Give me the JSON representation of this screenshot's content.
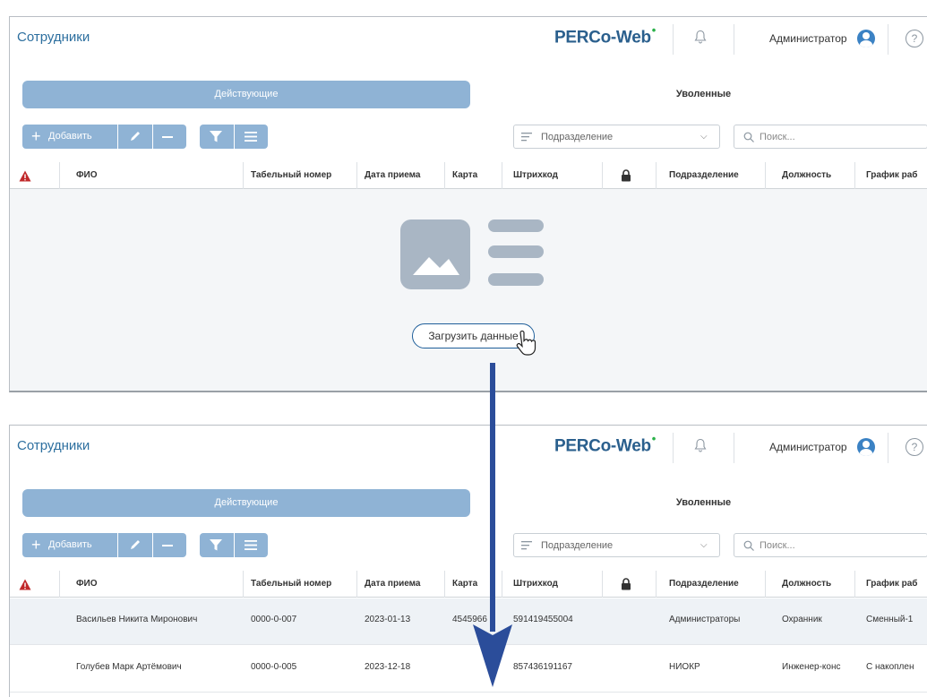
{
  "header": {
    "title": "Сотрудники",
    "logo_text": "PERCo-Web",
    "logo_dot": "•",
    "user_name": "Администратор",
    "help_label": "?"
  },
  "tabs": [
    {
      "label": "Действующие",
      "active": true
    },
    {
      "label": "Уволенные",
      "active": false
    }
  ],
  "toolbar": {
    "add_icon": "+",
    "add_label": "Добавить",
    "department_placeholder": "Подразделение",
    "search_placeholder": "Поиск..."
  },
  "columns": [
    "ФИО",
    "Табельный номер",
    "Дата приема",
    "Карта",
    "Штрихкод",
    "Подразделение",
    "Должность",
    "График раб"
  ],
  "empty_state": {
    "load_button": "Загрузить данные"
  },
  "rows": [
    {
      "fio": "Васильев Никита Миронович",
      "tab": "0000-0-007",
      "date": "2023-01-13",
      "card": "4545966",
      "barcode": "591419455004",
      "dept": "Администраторы",
      "pos": "Охранник",
      "sched": "Сменный-1"
    },
    {
      "fio": "Голубев Марк Артёмович",
      "tab": "0000-0-005",
      "date": "2023-12-18",
      "card": "",
      "barcode": "857436191167",
      "dept": "НИОКР",
      "pos": "Инженер-конс",
      "sched": "С накоплен"
    }
  ],
  "icons": [
    "bell-icon",
    "user-avatar-icon",
    "help-icon",
    "plus-icon",
    "pencil-icon",
    "minus-icon",
    "filter-icon",
    "menu-icon",
    "list-icon",
    "search-icon",
    "warning-icon",
    "lock-icon",
    "image-placeholder-icon",
    "hand-cursor-icon",
    "down-arrow-icon"
  ],
  "colors": {
    "accent": "#8fb3d5",
    "title": "#2d6f9f",
    "logo": "#2a5f8d",
    "logo_dot": "#2bb14a",
    "warning": "#c0282a",
    "arrow": "#2b4d9a"
  }
}
